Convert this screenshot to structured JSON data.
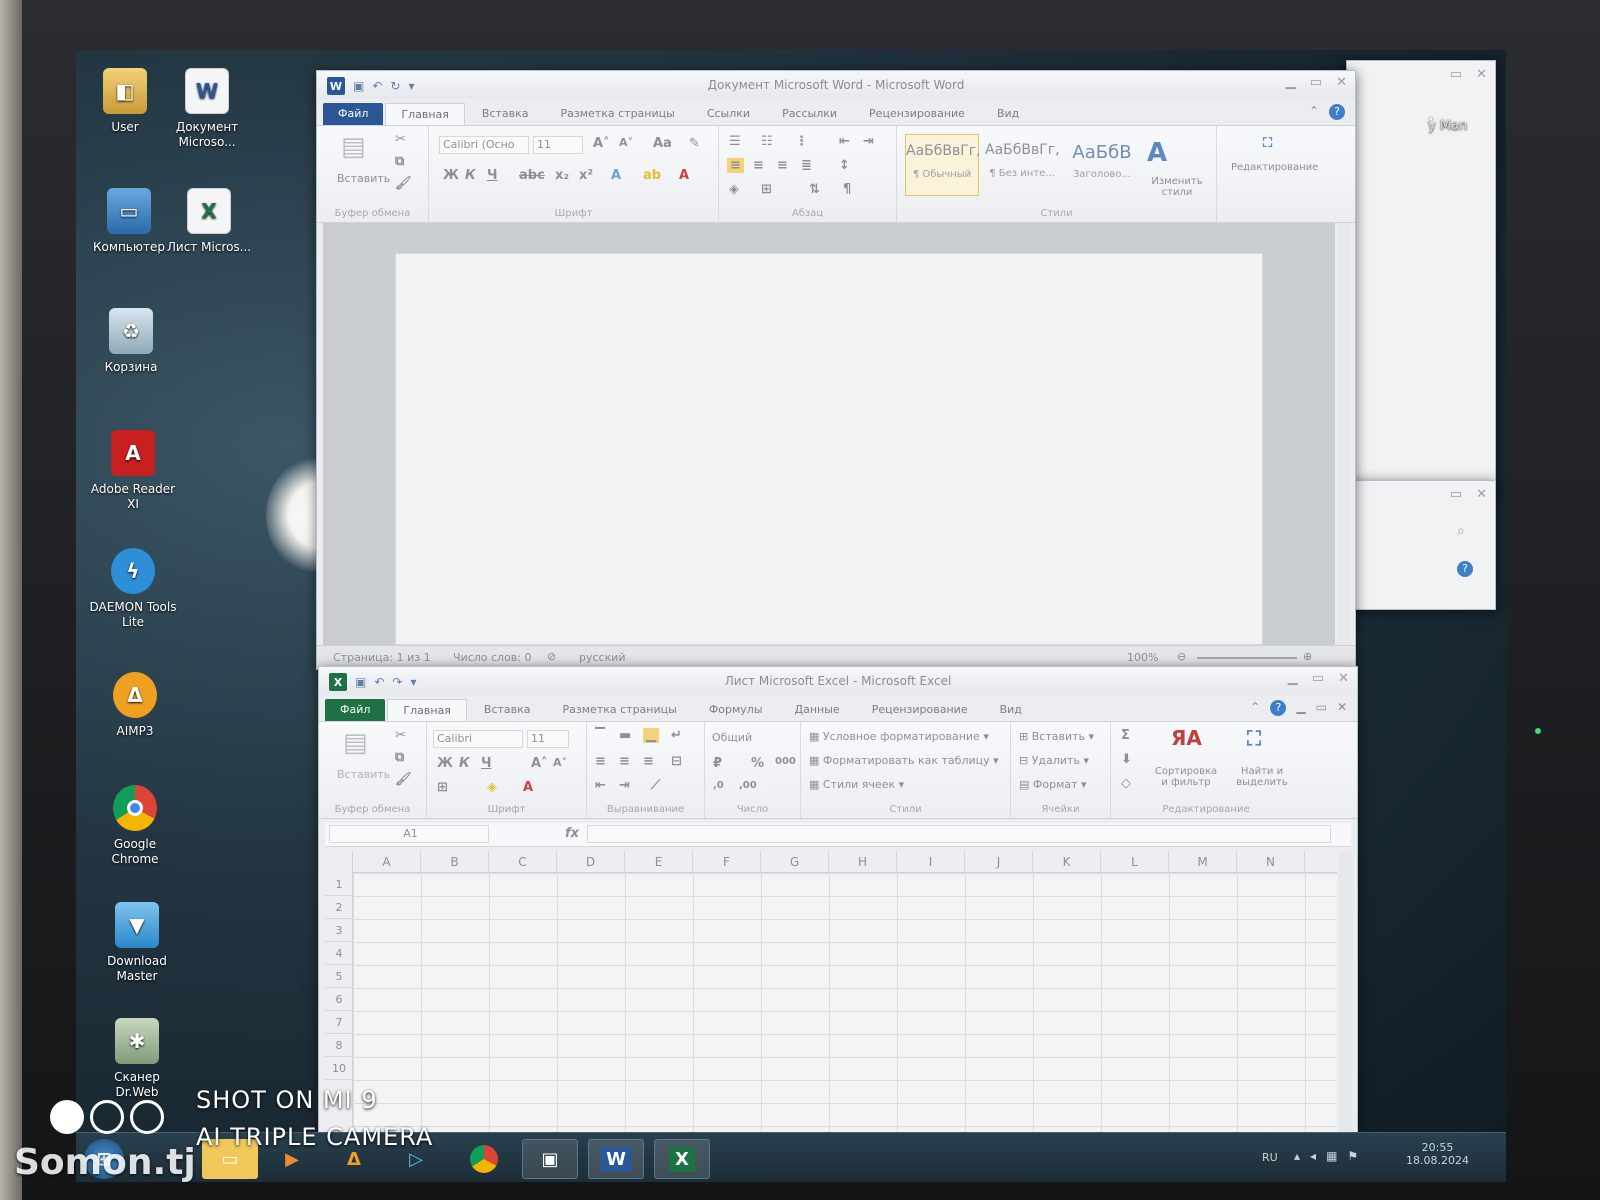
{
  "desktop": {
    "icons": [
      {
        "label": "User",
        "icon": "user-folder-icon"
      },
      {
        "label": "Документ Microso...",
        "icon": "word-document-icon"
      },
      {
        "label": "Компьютер",
        "icon": "computer-icon"
      },
      {
        "label": "Лист Micros...",
        "icon": "excel-sheet-icon"
      },
      {
        "label": "Корзина",
        "icon": "recycle-bin-icon"
      },
      {
        "label": "Adobe Reader XI",
        "icon": "adobe-reader-icon"
      },
      {
        "label": "DAEMON Tools Lite",
        "icon": "daemon-tools-icon"
      },
      {
        "label": "AIMP3",
        "icon": "aimp-icon"
      },
      {
        "label": "Google Chrome",
        "icon": "chrome-icon"
      },
      {
        "label": "Download Master",
        "icon": "download-master-icon"
      },
      {
        "label": "Сканер Dr.Web",
        "icon": "drweb-scanner-icon"
      }
    ],
    "bg_window_label": "y Man"
  },
  "word": {
    "title": "Документ Microsoft Word - Microsoft Word",
    "tabs": {
      "file": "Файл",
      "home": "Главная",
      "insert": "Вставка",
      "layout": "Разметка страницы",
      "refs": "Ссылки",
      "mailings": "Рассылки",
      "review": "Рецензирование",
      "view": "Вид"
    },
    "ribbon": {
      "paste": "Вставить",
      "clipboard": "Буфер обмена",
      "font_name": "Calibri (Осно",
      "font_size": "11",
      "font_group": "Шрифт",
      "paragraph_group": "Абзац",
      "styles_group": "Стили",
      "styles": [
        {
          "sample": "АаБбВвГг,",
          "name": "¶ Обычный"
        },
        {
          "sample": "АаБбВвГг,",
          "name": "¶ Без инте..."
        },
        {
          "sample": "АаБбВ",
          "name": "Заголово..."
        }
      ],
      "change_styles": "Изменить стили",
      "editing": "Редактирование"
    },
    "status": {
      "page": "Страница: 1 из 1",
      "words": "Число слов: 0",
      "lang": "русский",
      "zoom": "100%"
    }
  },
  "excel": {
    "title": "Лист Microsoft Excel - Microsoft Excel",
    "tabs": {
      "file": "Файл",
      "home": "Главная",
      "insert": "Вставка",
      "layout": "Разметка страницы",
      "formulas": "Формулы",
      "data": "Данные",
      "review": "Рецензирование",
      "view": "Вид"
    },
    "ribbon": {
      "paste": "Вставить",
      "clipboard": "Буфер обмена",
      "font_name": "Calibri",
      "font_size": "11",
      "font_group": "Шрифт",
      "align_group": "Выравнивание",
      "number_format": "Общий",
      "number_group": "Число",
      "cond_format": "Условное форматирование",
      "format_table": "Форматировать как таблицу",
      "cell_styles": "Стили ячеек",
      "styles_group": "Стили",
      "insert": "Вставить",
      "delete": "Удалить",
      "format": "Формат",
      "cells_group": "Ячейки",
      "sort": "Сортировка и фильтр",
      "find": "Найти и выделить",
      "editing_group": "Редактирование"
    },
    "name_box": "A1",
    "fx": "fx",
    "columns": [
      "A",
      "B",
      "C",
      "D",
      "E",
      "F",
      "G",
      "H",
      "I",
      "J",
      "K",
      "L",
      "M",
      "N"
    ],
    "rows": [
      "1",
      "2",
      "3",
      "4",
      "5",
      "6",
      "7",
      "8",
      "10"
    ]
  },
  "taskbar": {
    "lang": "RU",
    "time": "20:55",
    "date": "18.08.2024"
  },
  "watermark": {
    "line1": "SHOT ON MI 9",
    "line2": "AI TRIPLE CAMERA",
    "site": "Somon.tj"
  },
  "colors": {
    "word_blue": "#2b5797",
    "excel_green": "#1e7145",
    "office_blue": "#3f7fc9"
  }
}
